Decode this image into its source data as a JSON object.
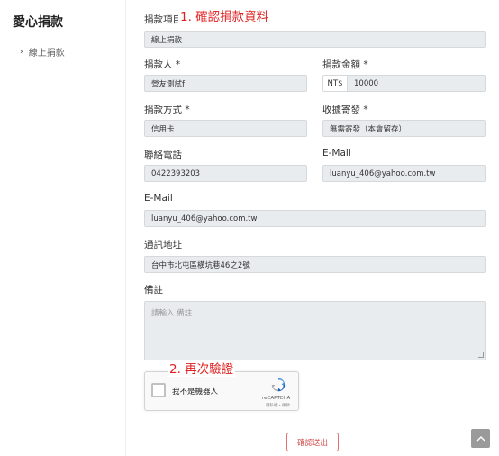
{
  "sidebar": {
    "title": "愛心捐款",
    "items": [
      {
        "label": "線上捐款"
      }
    ]
  },
  "form": {
    "donation_item": {
      "label": "捐款項目 *",
      "value": "線上捐款"
    },
    "donor": {
      "label": "捐款人 *",
      "value": "營友測試f"
    },
    "amount": {
      "label": "捐款金額 *",
      "currency": "NT$",
      "value": "10000"
    },
    "payment_method": {
      "label": "捐款方式 *",
      "value": "信用卡"
    },
    "receipt": {
      "label": "收據寄發 *",
      "value": "無需寄發（本會留存）"
    },
    "phone": {
      "label": "聯絡電話",
      "value": "0422393203"
    },
    "email_right": {
      "label": "E-Mail",
      "value": "luanyu_406@yahoo.com.tw"
    },
    "email": {
      "label": "E-Mail",
      "value": "luanyu_406@yahoo.com.tw"
    },
    "address": {
      "label": "通訊地址",
      "value": "台中市北屯區橫坑巷46之2號"
    },
    "notes": {
      "label": "備註",
      "placeholder": "請輸入 備註"
    }
  },
  "annotations": {
    "step1": "1. 確認捐款資料",
    "step2": "2. 再次驗證"
  },
  "recaptcha": {
    "checkbox_label": "我不是機器人",
    "brand": "reCAPTCHA",
    "terms": "隱私權・條款"
  },
  "actions": {
    "submit_label": "確認送出"
  },
  "colors": {
    "annotation": "#e02020",
    "submit_border": "#e07070",
    "field_bg": "#e9ecef"
  }
}
